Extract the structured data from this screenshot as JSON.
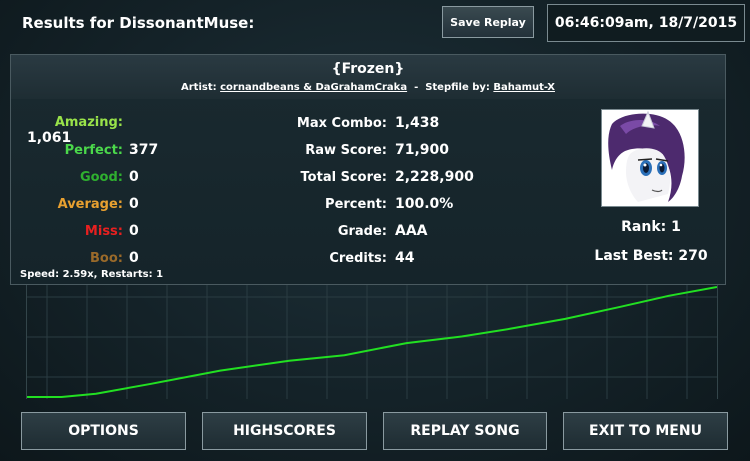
{
  "header": {
    "title": "Results for DissonantMuse:",
    "save_replay_label": "Save Replay",
    "datetime": "06:46:09am, 18/7/2015"
  },
  "song": {
    "title": "{Frozen}",
    "artist_prefix": "Artist:",
    "artist": "cornandbeans & DaGrahamCraka",
    "separator": "-",
    "stepfile_prefix": "Stepfile by:",
    "stepfile_author": "Bahamut-X"
  },
  "judgements": [
    {
      "label": "Amazing:",
      "value": "1,061",
      "color": "#99e34a"
    },
    {
      "label": "Perfect:",
      "value": "377",
      "color": "#4bd84b"
    },
    {
      "label": "Good:",
      "value": "0",
      "color": "#2fb02f"
    },
    {
      "label": "Average:",
      "value": "0",
      "color": "#e8a030"
    },
    {
      "label": "Miss:",
      "value": "0",
      "color": "#e82020"
    },
    {
      "label": "Boo:",
      "value": "0",
      "color": "#9a6a2a"
    }
  ],
  "stats": [
    {
      "label": "Max Combo:",
      "value": "1,438"
    },
    {
      "label": "Raw Score:",
      "value": "71,900"
    },
    {
      "label": "Total Score:",
      "value": "2,228,900"
    },
    {
      "label": "Percent:",
      "value": "100.0%"
    },
    {
      "label": "Grade:",
      "value": "AAA"
    },
    {
      "label": "Credits:",
      "value": "44"
    }
  ],
  "speed_line": "Speed: 2.59x, Restarts: 1",
  "avatar_icon": "pony-avatar-icon",
  "rank": "Rank: 1",
  "last_best": "Last Best: 270",
  "graph": {
    "line_color": "#22e022",
    "grid_color": "#2a3c42",
    "points": [
      [
        0,
        0
      ],
      [
        0.05,
        0
      ],
      [
        0.1,
        0.03
      ],
      [
        0.18,
        0.12
      ],
      [
        0.28,
        0.24
      ],
      [
        0.38,
        0.33
      ],
      [
        0.46,
        0.38
      ],
      [
        0.55,
        0.49
      ],
      [
        0.63,
        0.55
      ],
      [
        0.7,
        0.62
      ],
      [
        0.78,
        0.71
      ],
      [
        0.86,
        0.82
      ],
      [
        0.93,
        0.92
      ],
      [
        1,
        1
      ]
    ]
  },
  "buttons": {
    "options": "OPTIONS",
    "highscores": "HIGHSCORES",
    "replay_song": "REPLAY SONG",
    "exit_to_menu": "EXIT TO MENU"
  }
}
